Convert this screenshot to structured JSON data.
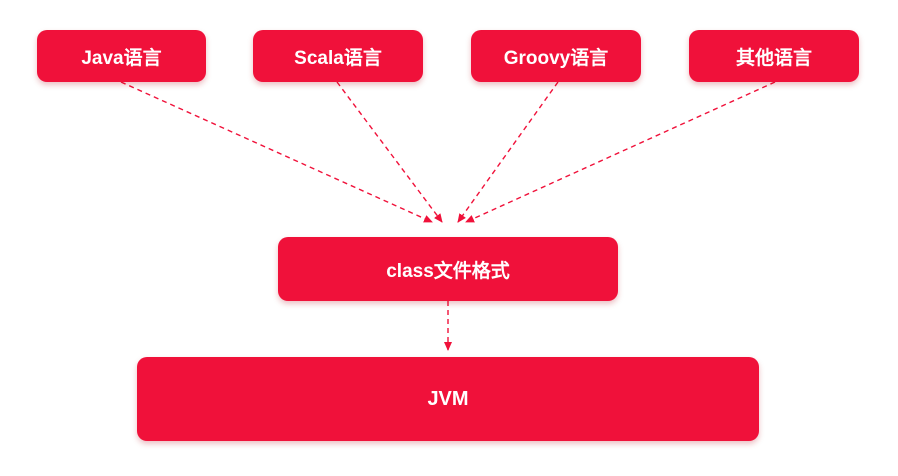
{
  "colors": {
    "box_fill": "#f0113a",
    "arrow": "#f0113a",
    "text": "#ffffff"
  },
  "sources": [
    {
      "label": "Java语言"
    },
    {
      "label": "Scala语言"
    },
    {
      "label": "Groovy语言"
    },
    {
      "label": "其他语言"
    }
  ],
  "middle": {
    "label": "class文件格式"
  },
  "target": {
    "label": "JVM"
  }
}
